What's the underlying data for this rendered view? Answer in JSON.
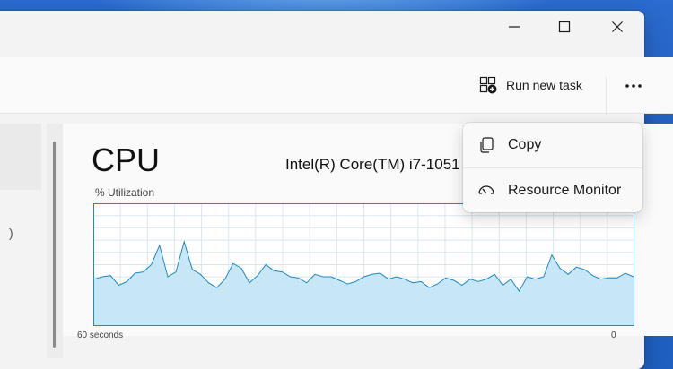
{
  "toolbar": {
    "run_new_task_label": "Run new task",
    "run_new_task_icon": "run-task-icon",
    "more_icon": "more-options-icon"
  },
  "caption": {
    "minimize_icon": "minimize-icon",
    "maximize_icon": "maximize-icon",
    "close_icon": "close-icon"
  },
  "performance": {
    "title": "CPU",
    "cpu_name": "Intel(R) Core(TM) i7-1051",
    "utilization_label": "% Utilization",
    "axis_left_stub": "60 seconds",
    "axis_right_stub": "0",
    "utilization_percent": [
      38,
      40,
      41,
      33,
      36,
      43,
      44,
      50,
      66,
      40,
      44,
      69,
      46,
      42,
      35,
      31,
      38,
      51,
      47,
      35,
      41,
      50,
      45,
      44,
      40,
      39,
      35,
      42,
      40,
      40,
      37,
      34,
      36,
      40,
      42,
      43,
      38,
      40,
      38,
      35,
      36,
      31,
      34,
      39,
      37,
      33,
      38,
      36,
      38,
      42,
      33,
      38,
      28,
      40,
      38,
      40,
      58,
      47,
      42,
      48,
      46,
      41,
      38,
      39,
      39,
      43,
      40
    ]
  },
  "context_menu": {
    "items": [
      {
        "label": "Copy",
        "icon": "copy-icon"
      },
      {
        "label": "Resource Monitor",
        "icon": "resource-monitor-icon"
      }
    ]
  },
  "colors": {
    "graph_line": "#1d89c7",
    "graph_fill": "#c8e7f6",
    "graph_grid": "#d8e7f0"
  }
}
